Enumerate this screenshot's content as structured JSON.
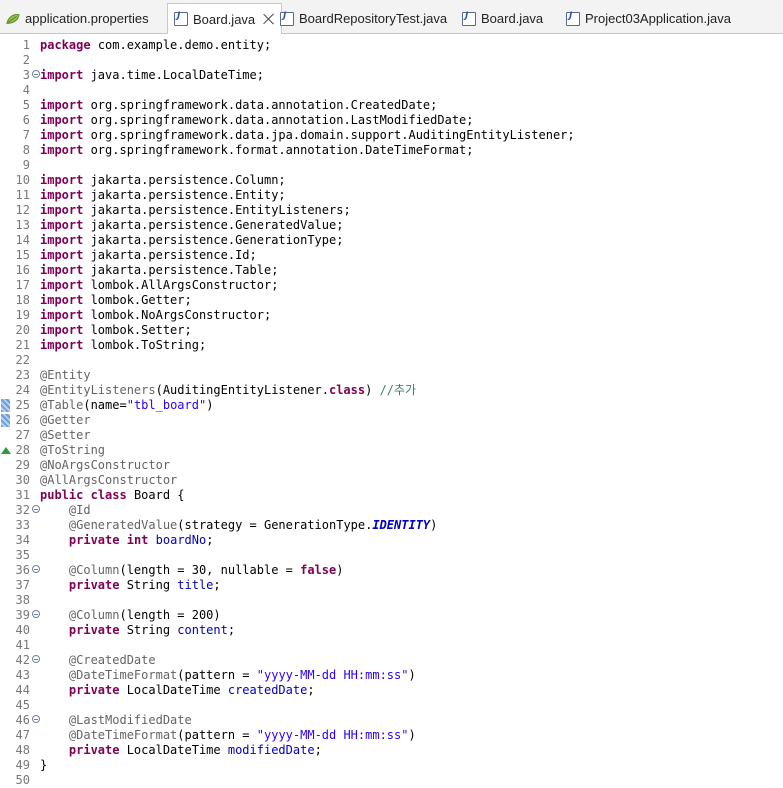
{
  "tabs": [
    {
      "label": "application.properties",
      "icon": "properties-leaf-icon"
    },
    {
      "label": "Board.java",
      "icon": "java-file-icon",
      "active": true
    },
    {
      "label": "BoardRepositoryTest.java",
      "icon": "java-file-icon"
    },
    {
      "label": "Board.java",
      "icon": "java-file-icon"
    },
    {
      "label": "Project03Application.java",
      "icon": "java-file-icon"
    }
  ],
  "code_lines": [
    {
      "n": "1",
      "t": [
        [
          "kw",
          "package"
        ],
        [
          "",
          "com.example.demo.entity;"
        ]
      ]
    },
    {
      "n": "2",
      "t": []
    },
    {
      "n": "3",
      "f": true,
      "t": [
        [
          "kw",
          "import"
        ],
        [
          "",
          " java.time.LocalDateTime;"
        ]
      ]
    },
    {
      "n": "4",
      "t": []
    },
    {
      "n": "5",
      "t": [
        [
          "kw",
          "import"
        ],
        [
          "",
          " org.springframework.data.annotation.CreatedDate;"
        ]
      ]
    },
    {
      "n": "6",
      "t": [
        [
          "kw",
          "import"
        ],
        [
          "",
          " org.springframework.data.annotation.LastModifiedDate;"
        ]
      ]
    },
    {
      "n": "7",
      "t": [
        [
          "kw",
          "import"
        ],
        [
          "",
          " org.springframework.data.jpa.domain.support.AuditingEntityListener;"
        ]
      ]
    },
    {
      "n": "8",
      "t": [
        [
          "kw",
          "import"
        ],
        [
          "",
          " org.springframework.format.annotation.DateTimeFormat;"
        ]
      ]
    },
    {
      "n": "9",
      "t": []
    },
    {
      "n": "10",
      "t": [
        [
          "kw",
          "import"
        ],
        [
          "",
          " jakarta.persistence.Column;"
        ]
      ]
    },
    {
      "n": "11",
      "t": [
        [
          "kw",
          "import"
        ],
        [
          "",
          " jakarta.persistence.Entity;"
        ]
      ]
    },
    {
      "n": "12",
      "t": [
        [
          "kw",
          "import"
        ],
        [
          "",
          " jakarta.persistence.EntityListeners;"
        ]
      ]
    },
    {
      "n": "13",
      "t": [
        [
          "kw",
          "import"
        ],
        [
          "",
          " jakarta.persistence.GeneratedValue;"
        ]
      ]
    },
    {
      "n": "14",
      "t": [
        [
          "kw",
          "import"
        ],
        [
          "",
          " jakarta.persistence.GenerationType;"
        ]
      ]
    },
    {
      "n": "15",
      "t": [
        [
          "kw",
          "import"
        ],
        [
          "",
          " jakarta.persistence.Id;"
        ]
      ]
    },
    {
      "n": "16",
      "t": [
        [
          "kw",
          "import"
        ],
        [
          "",
          " jakarta.persistence.Table;"
        ]
      ]
    },
    {
      "n": "17",
      "t": [
        [
          "kw",
          "import"
        ],
        [
          "",
          " lombok.AllArgsConstructor;"
        ]
      ]
    },
    {
      "n": "18",
      "t": [
        [
          "kw",
          "import"
        ],
        [
          "",
          " lombok.Getter;"
        ]
      ]
    },
    {
      "n": "19",
      "t": [
        [
          "kw",
          "import"
        ],
        [
          "",
          " lombok.NoArgsConstructor;"
        ]
      ]
    },
    {
      "n": "20",
      "t": [
        [
          "kw",
          "import"
        ],
        [
          "",
          " lombok.Setter;"
        ]
      ]
    },
    {
      "n": "21",
      "t": [
        [
          "kw",
          "import"
        ],
        [
          "",
          " lombok.ToString;"
        ]
      ]
    },
    {
      "n": "22",
      "t": []
    },
    {
      "n": "23",
      "t": [
        [
          "an",
          "@Entity"
        ]
      ]
    },
    {
      "n": "24",
      "t": [
        [
          "an",
          "@EntityListeners"
        ],
        [
          "",
          "(AuditingEntityListener."
        ],
        [
          "kw",
          "class"
        ],
        [
          "",
          ") "
        ],
        [
          "cmt",
          "//추가"
        ]
      ]
    },
    {
      "n": "25",
      "m": "blue",
      "t": [
        [
          "an",
          "@Table"
        ],
        [
          "",
          "(name="
        ],
        [
          "str",
          "\"tbl_board\""
        ],
        [
          "",
          ")"
        ]
      ]
    },
    {
      "n": "26",
      "m": "blue",
      "t": [
        [
          "an",
          "@Getter"
        ]
      ]
    },
    {
      "n": "27",
      "t": [
        [
          "an",
          "@Setter"
        ]
      ]
    },
    {
      "n": "28",
      "m": "tri",
      "t": [
        [
          "an",
          "@ToString"
        ]
      ]
    },
    {
      "n": "29",
      "t": [
        [
          "an",
          "@NoArgsConstructor"
        ]
      ]
    },
    {
      "n": "30",
      "t": [
        [
          "an",
          "@AllArgsConstructor"
        ]
      ]
    },
    {
      "n": "31",
      "t": [
        [
          "kw",
          "public"
        ],
        [
          "",
          " "
        ],
        [
          "kw",
          "class"
        ],
        [
          "",
          " Board {"
        ]
      ]
    },
    {
      "n": "32",
      "f": true,
      "t": [
        [
          "",
          "    "
        ],
        [
          "an",
          "@Id"
        ]
      ]
    },
    {
      "n": "33",
      "t": [
        [
          "",
          "    "
        ],
        [
          "an",
          "@GeneratedValue"
        ],
        [
          "",
          "(strategy = GenerationType."
        ],
        [
          "sfld",
          "IDENTITY"
        ],
        [
          "",
          ")"
        ]
      ]
    },
    {
      "n": "34",
      "t": [
        [
          "",
          "    "
        ],
        [
          "kw",
          "private"
        ],
        [
          "",
          " "
        ],
        [
          "kw",
          "int"
        ],
        [
          "",
          " "
        ],
        [
          "fld",
          "boardNo"
        ],
        [
          "",
          ";"
        ]
      ]
    },
    {
      "n": "35",
      "t": []
    },
    {
      "n": "36",
      "f": true,
      "t": [
        [
          "",
          "    "
        ],
        [
          "an",
          "@Column"
        ],
        [
          "",
          "(length = 30, nullable = "
        ],
        [
          "kw",
          "false"
        ],
        [
          "",
          ")"
        ]
      ]
    },
    {
      "n": "37",
      "t": [
        [
          "",
          "    "
        ],
        [
          "kw",
          "private"
        ],
        [
          "",
          " String "
        ],
        [
          "fld",
          "title"
        ],
        [
          "",
          ";"
        ]
      ]
    },
    {
      "n": "38",
      "t": []
    },
    {
      "n": "39",
      "f": true,
      "t": [
        [
          "",
          "    "
        ],
        [
          "an",
          "@Column"
        ],
        [
          "",
          "(length = 200)"
        ]
      ]
    },
    {
      "n": "40",
      "t": [
        [
          "",
          "    "
        ],
        [
          "kw",
          "private"
        ],
        [
          "",
          " String "
        ],
        [
          "fld",
          "content"
        ],
        [
          "",
          ";"
        ]
      ]
    },
    {
      "n": "41",
      "t": []
    },
    {
      "n": "42",
      "f": true,
      "t": [
        [
          "",
          "    "
        ],
        [
          "an",
          "@CreatedDate"
        ]
      ]
    },
    {
      "n": "43",
      "t": [
        [
          "",
          "    "
        ],
        [
          "an",
          "@DateTimeFormat"
        ],
        [
          "",
          "(pattern = "
        ],
        [
          "str",
          "\"yyyy-MM-dd HH:mm:ss\""
        ],
        [
          "",
          ")"
        ]
      ]
    },
    {
      "n": "44",
      "t": [
        [
          "",
          "    "
        ],
        [
          "kw",
          "private"
        ],
        [
          "",
          " LocalDateTime "
        ],
        [
          "fld",
          "createdDate"
        ],
        [
          "",
          ";"
        ]
      ]
    },
    {
      "n": "45",
      "t": []
    },
    {
      "n": "46",
      "f": true,
      "t": [
        [
          "",
          "    "
        ],
        [
          "an",
          "@LastModifiedDate"
        ]
      ]
    },
    {
      "n": "47",
      "t": [
        [
          "",
          "    "
        ],
        [
          "an",
          "@DateTimeFormat"
        ],
        [
          "",
          "(pattern = "
        ],
        [
          "str",
          "\"yyyy-MM-dd HH:mm:ss\""
        ],
        [
          "",
          ")"
        ]
      ]
    },
    {
      "n": "48",
      "t": [
        [
          "",
          "    "
        ],
        [
          "kw",
          "private"
        ],
        [
          "",
          " LocalDateTime "
        ],
        [
          "fld",
          "modifiedDate"
        ],
        [
          "",
          ";"
        ]
      ]
    },
    {
      "n": "49",
      "t": [
        [
          "",
          "}"
        ]
      ]
    },
    {
      "n": "50",
      "t": []
    }
  ]
}
